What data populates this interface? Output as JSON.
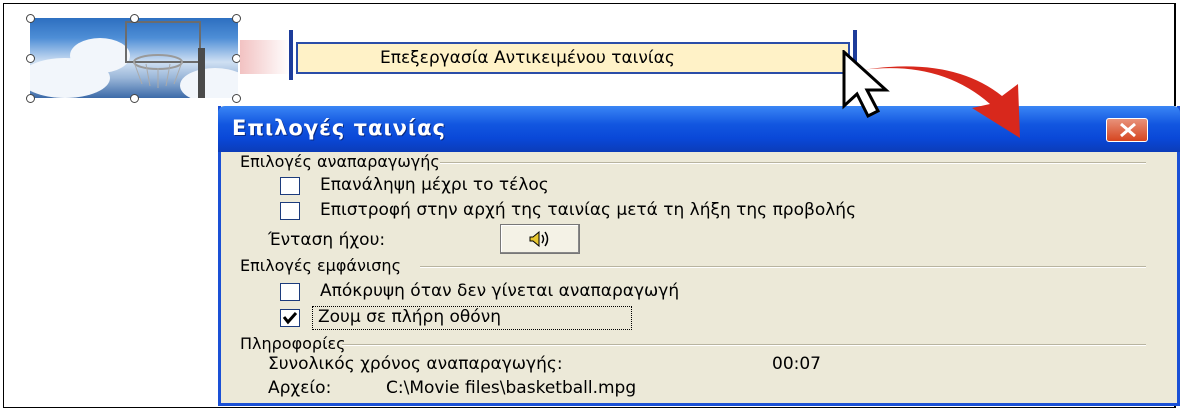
{
  "context_menu": {
    "label": "Επεξεργασία Αντικειμένου ταινίας"
  },
  "dialog": {
    "title": "Επιλογές ταινίας",
    "playback": {
      "heading": "Επιλογές αναπαραγωγής",
      "loop_label": "Επανάληψη μέχρι το τέλος",
      "loop_checked": false,
      "rewind_label": "Επιστροφή στην αρχή της ταινίας μετά τη λήξη της προβολής",
      "rewind_checked": false,
      "volume_label": "Ένταση ήχου:"
    },
    "display": {
      "heading": "Επιλογές εμφάνισης",
      "hide_label": "Απόκρυψη όταν δεν γίνεται αναπαραγωγή",
      "hide_checked": false,
      "zoom_label": "Ζουμ σε πλήρη οθόνη",
      "zoom_checked": true
    },
    "info": {
      "heading": "Πληροφορίες",
      "total_label": "Συνολικός χρόνος αναπαραγωγής:",
      "total_value": "00:07",
      "file_label": "Αρχείο:",
      "file_value": "C:\\Movie files\\basketball.mpg"
    }
  },
  "colors": {
    "title_bar": "#0a48d8",
    "dialog_bg": "#ece9d8",
    "menu_highlight": "#fff2c7",
    "close_button": "#d64520",
    "arrow": "#d8281c"
  }
}
